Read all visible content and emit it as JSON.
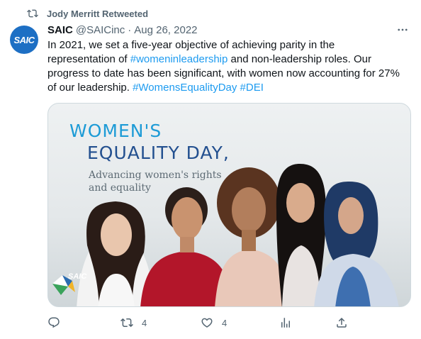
{
  "retweet": {
    "icon": "retweet-icon",
    "label": "Jody Merritt Retweeted"
  },
  "author": {
    "avatar_text": "SAIC",
    "display_name": "SAIC",
    "handle": "@SAICinc",
    "separator": "·",
    "date": "Aug 26, 2022"
  },
  "tweet": {
    "line1": "In 2021, we set a five-year objective of achieving parity in the",
    "line2_pre": "representation of ",
    "line2_tag": "#womeninleadership",
    "line2_post": " and non-leadership roles. Our",
    "line3": "progress to date has been significant, with women now accounting for 27%",
    "line4_pre": "of our leadership. ",
    "line4_tag1": "#WomensEqualityDay",
    "line4_space": " ",
    "line4_tag2": "#DEI"
  },
  "media": {
    "headline_1": "WOMEN'S",
    "headline_2": "EQUALITY DAY,",
    "sub_1": "Advancing women's rights",
    "sub_2": "and equality",
    "logo_text": "SAIC"
  },
  "actions": {
    "reply_count": "",
    "retweet_count": "4",
    "like_count": "4"
  },
  "colors": {
    "accent": "#1d9bf0",
    "muted": "#536471",
    "brand": "#1d6fc4"
  }
}
